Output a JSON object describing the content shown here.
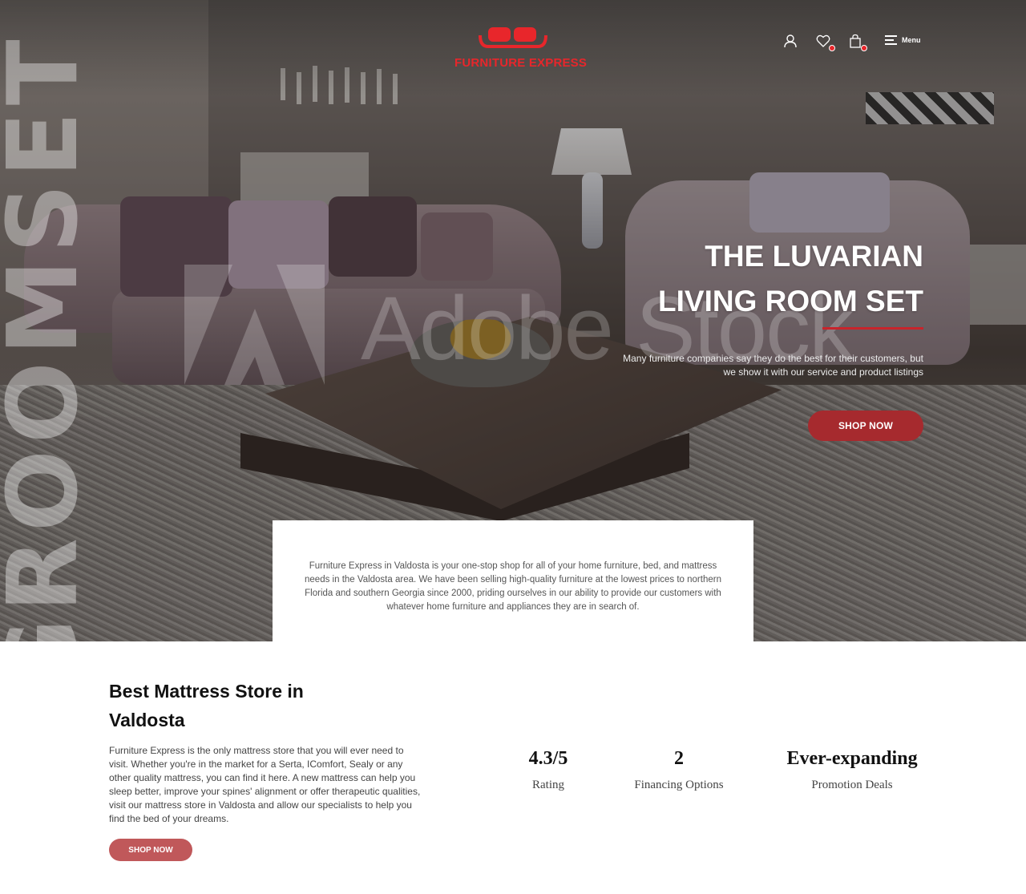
{
  "brand": {
    "name": "FURNITURE EXPRESS",
    "accent_color": "#e8262b",
    "logo_icon": "sofa-icon"
  },
  "header": {
    "icons": [
      {
        "name": "user-icon"
      },
      {
        "name": "wishlist-heart-icon"
      },
      {
        "name": "shopping-bag-icon"
      }
    ],
    "menu_label": "Menu",
    "menu_icon": "hamburger-icon"
  },
  "hero": {
    "vertical_text": "GROOMSET",
    "watermark": "Adobe Stock",
    "title_line1": "THE LUVARIAN",
    "title_line2": "LIVING ROOM SET",
    "subtitle_line1": "Many furniture companies say they do the best for their customers, but",
    "subtitle_line2": "we show it with our service and product listings",
    "cta_label": "SHOP NOW",
    "cta_color": "#a62a2e"
  },
  "intro": {
    "text": "Furniture Express in Valdosta is your one-stop shop for all of your home furniture, bed, and mattress needs in the Valdosta area. We have been selling high-quality furniture at the lowest prices to northern Florida and southern Georgia since 2000, priding ourselves in our ability to provide our customers with whatever home furniture and appliances they are in search of."
  },
  "mattress": {
    "title_line1": "Best Mattress Store in",
    "title_line2": "Valdosta",
    "body": "Furniture Express is the only mattress store that you will ever need to visit. Whether you're in the market for a Serta, IComfort, Sealy or any other quality mattress, you can find it here. A new mattress can help you sleep better, improve your spines' alignment or offer therapeutic qualities, visit our mattress store in Valdosta and allow our specialists to help you find the bed of your dreams.",
    "cta_label": "SHOP NOW",
    "cta_color": "#c0585a"
  },
  "stats": [
    {
      "value": "4.3/5",
      "label": "Rating"
    },
    {
      "value": "2",
      "label": "Financing Options"
    },
    {
      "value": "Ever-expanding",
      "label": "Promotion Deals"
    }
  ]
}
